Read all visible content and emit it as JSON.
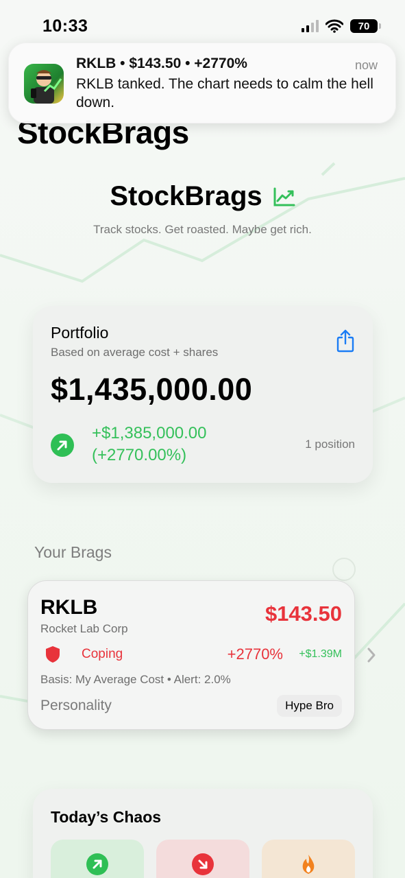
{
  "status_bar": {
    "time": "10:33",
    "battery": "70"
  },
  "notification": {
    "title": "RKLB • $143.50 • +2770%",
    "time": "now",
    "body": "RKLB tanked. The chart needs to calm the hell down."
  },
  "large_title": "StockBrags",
  "brand": {
    "name": "StockBrags",
    "tagline": "Track stocks. Get roasted. Maybe get rich."
  },
  "portfolio": {
    "title": "Portfolio",
    "subtitle": "Based on average cost + shares",
    "value": "$1,435,000.00",
    "change_line1": "+$1,385,000.00",
    "change_line2": "(+2770.00%)",
    "positions": "1 position"
  },
  "section_label": "Your Brags",
  "brag": {
    "ticker": "RKLB",
    "company": "Rocket Lab Corp",
    "price": "$143.50",
    "mood": "Coping",
    "percent": "+2770%",
    "gain": "+$1.39M",
    "basis": "Basis: My Average Cost • Alert: 2.0%",
    "personality_label": "Personality",
    "personality_value": "Hype Bro"
  },
  "chaos": {
    "title": "Today’s Chaos"
  },
  "colors": {
    "accent_green": "#34c05a",
    "accent_red": "#e8333b",
    "share_blue": "#1a7cf5"
  },
  "icons": {
    "status": [
      "signal-icon",
      "wifi-icon",
      "battery-icon"
    ],
    "brand": "trend-chart-icon",
    "portfolio": [
      "share-icon",
      "arrow-up-right-icon"
    ],
    "brag": [
      "shield-icon",
      "chevron-right-icon"
    ],
    "chaos": [
      "arrow-up-right-icon",
      "arrow-down-right-icon",
      "flame-icon"
    ]
  }
}
